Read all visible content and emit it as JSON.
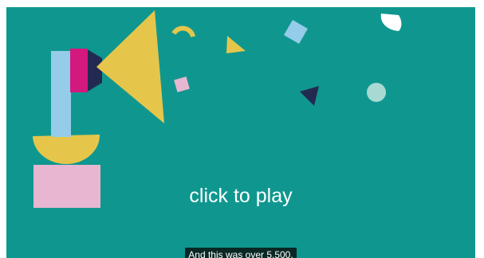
{
  "video": {
    "overlay_text": "click to play",
    "caption": "And this was over 5,500.",
    "background_color": "#0f978f",
    "artwork": {
      "shapes": [
        "blue-pillar",
        "magenta-block",
        "yellow-megaphone-triangle",
        "yellow-bowl",
        "pink-base",
        "yellow-arc",
        "yellow-small-triangle",
        "blue-diamond",
        "pink-square",
        "navy-triangle",
        "mint-circle",
        "white-crescent"
      ],
      "colors": {
        "teal": "#0f978f",
        "yellow": "#e5c64b",
        "light_blue": "#94cce9",
        "magenta": "#d3197d",
        "navy": "#232a52",
        "pink": "#e7b6d1",
        "mint": "#a8d9d3",
        "white": "#ffffff"
      }
    }
  }
}
